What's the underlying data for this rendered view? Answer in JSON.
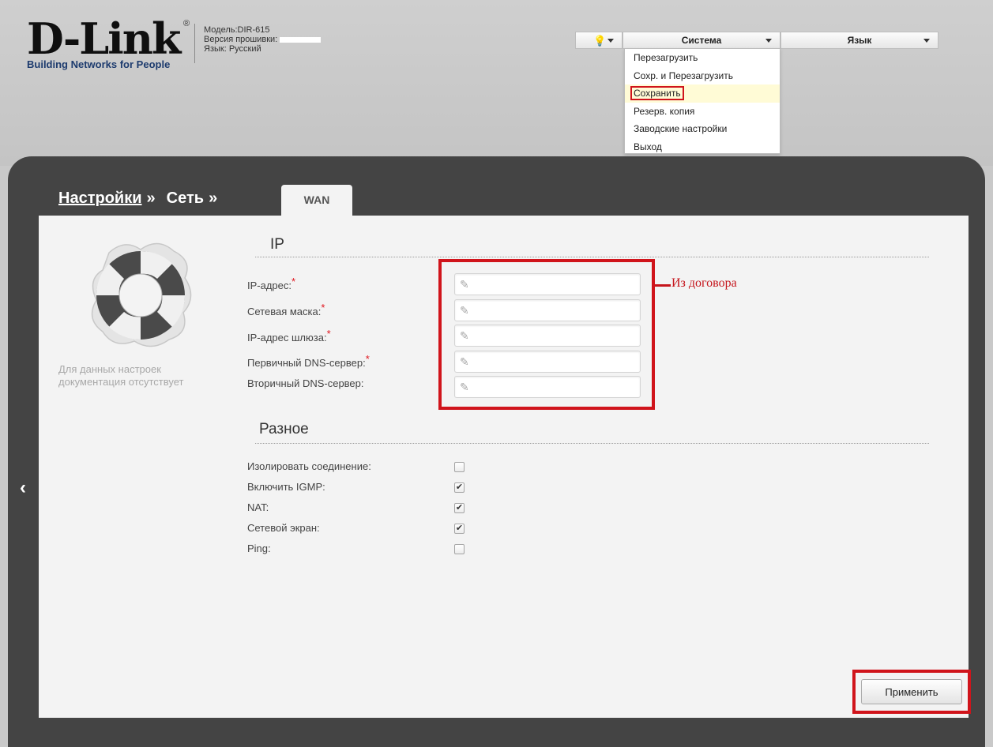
{
  "header": {
    "logo_text": "D-Link",
    "logo_tagline": "Building Networks for People",
    "model": "Модель:DIR-615",
    "firmware_label": "Версия прошивки:",
    "language_line": "Язык: Русский"
  },
  "toolbar": {
    "help_icon": "lightbulb-icon",
    "system_label": "Система",
    "language_label": "Язык"
  },
  "system_menu": {
    "items": [
      "Перезагрузить",
      "Сохр. и Перезагрузить",
      "Сохранить",
      "Резерв. копия",
      "Заводские настройки",
      "Выход"
    ],
    "highlighted_index": 2
  },
  "breadcrumb": {
    "settings": "Настройки",
    "network": "Сеть",
    "separator": "»",
    "tab": "WAN"
  },
  "sidebar": {
    "icon": "lifebuoy-icon",
    "no_doc_line1": "Для данных настроек",
    "no_doc_line2": "документация отсутствует"
  },
  "ip_section": {
    "title": "IP",
    "fields": [
      {
        "label": "IP-адрес:",
        "required": true,
        "value": ""
      },
      {
        "label": "Сетевая маска:",
        "required": true,
        "value": ""
      },
      {
        "label": "IP-адрес шлюза:",
        "required": true,
        "value": ""
      },
      {
        "label": "Первичный DNS-сервер:",
        "required": true,
        "value": ""
      },
      {
        "label": "Вторичный DNS-сервер:",
        "required": false,
        "value": ""
      }
    ],
    "required_mark": "*",
    "annotation": "Из договора"
  },
  "misc_section": {
    "title": "Разное",
    "options": [
      {
        "label": "Изолировать соединение:",
        "checked": false
      },
      {
        "label": "Включить IGMP:",
        "checked": true
      },
      {
        "label": "NAT:",
        "checked": true
      },
      {
        "label": "Сетевой экран:",
        "checked": true
      },
      {
        "label": "Ping:",
        "checked": false
      }
    ]
  },
  "apply_button": "Применить",
  "nav": {
    "left_arrow": "‹"
  },
  "colors": {
    "accent_red": "#d0141b",
    "panel_dark": "#444444",
    "content_bg": "#f3f3f3"
  }
}
